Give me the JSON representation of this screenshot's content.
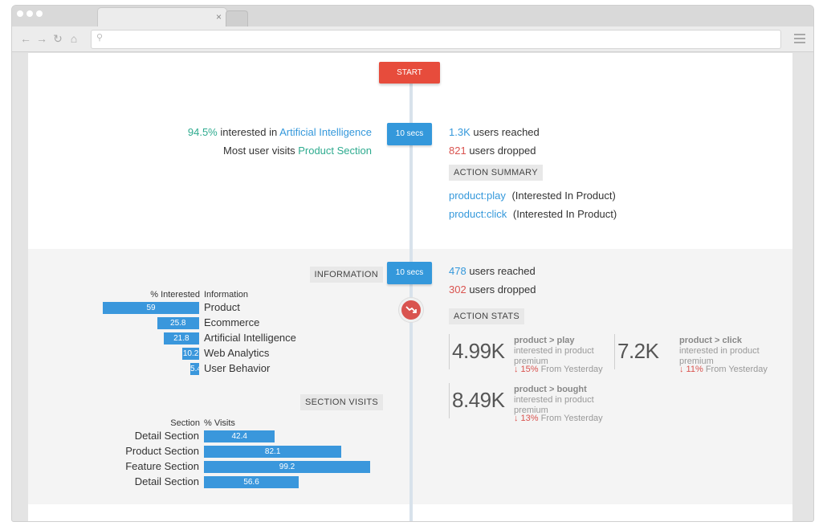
{
  "browser": {
    "tab_close": "×",
    "icons": [
      "back-icon",
      "forward-icon",
      "reload-icon",
      "home-icon",
      "search-icon",
      "menu-icon"
    ]
  },
  "timeline": {
    "start_label": "START",
    "step1": {
      "time_label": "10 secs",
      "interest_pct": "94.5%",
      "interest_text": "interested in",
      "interest_topic": "Artificial Intelligence",
      "visits_text": "Most user visits",
      "visits_section": "Product Section",
      "reached_value": "1.3K",
      "reached_text": "users reached",
      "dropped_value": "821",
      "dropped_text": "users dropped",
      "summary_title": "ACTION SUMMARY",
      "actions": [
        {
          "name": "product:play",
          "note": "(Interested In Product)"
        },
        {
          "name": "product:click",
          "note": "(Interested In Product)"
        }
      ]
    },
    "step2": {
      "time_label": "10 secs",
      "reached_value": "478",
      "reached_text": "users reached",
      "dropped_value": "302",
      "dropped_text": "users dropped",
      "information_title": "INFORMATION",
      "info_col1": "% Interested",
      "info_col2": "Information",
      "info_rows": [
        {
          "value": 59,
          "label": "59",
          "name": "Product"
        },
        {
          "value": 25.8,
          "label": "25.8",
          "name": "Ecommerce"
        },
        {
          "value": 21.8,
          "label": "21.8",
          "name": "Artificial Intelligence"
        },
        {
          "value": 10.2,
          "label": "10.2",
          "name": "Web Analytics"
        },
        {
          "value": 5.4,
          "label": "5.4",
          "name": "User Behavior"
        }
      ],
      "section_visits_title": "SECTION VISITS",
      "visits_col1": "Section",
      "visits_col2": "% Visits",
      "visit_rows": [
        {
          "name": "Detail Section",
          "value": 42.4,
          "label": "42.4"
        },
        {
          "name": "Product Section",
          "value": 82.1,
          "label": "82.1"
        },
        {
          "name": "Feature Section",
          "value": 99.2,
          "label": "99.2"
        },
        {
          "name": "Detail Section",
          "value": 56.6,
          "label": "56.6"
        }
      ],
      "action_stats_title": "ACTION STATS",
      "stats": [
        {
          "value": "4.99K",
          "name": "product > play",
          "desc": "interested in product premium",
          "arrow": "↓",
          "pct": "15%",
          "change_text": "From Yesterday"
        },
        {
          "value": "7.2K",
          "name": "product > click",
          "desc": "interested in product premium",
          "arrow": "↓",
          "pct": "11%",
          "change_text": "From Yesterday"
        },
        {
          "value": "8.49K",
          "name": "product > bought",
          "desc": "interested in product premium",
          "arrow": "↓",
          "pct": "13%",
          "change_text": "From Yesterday"
        }
      ]
    }
  },
  "colors": {
    "accent_blue": "#3498db",
    "start_red": "#e74c3c",
    "teal": "#2eab8f",
    "drop_red": "#d9534f"
  }
}
